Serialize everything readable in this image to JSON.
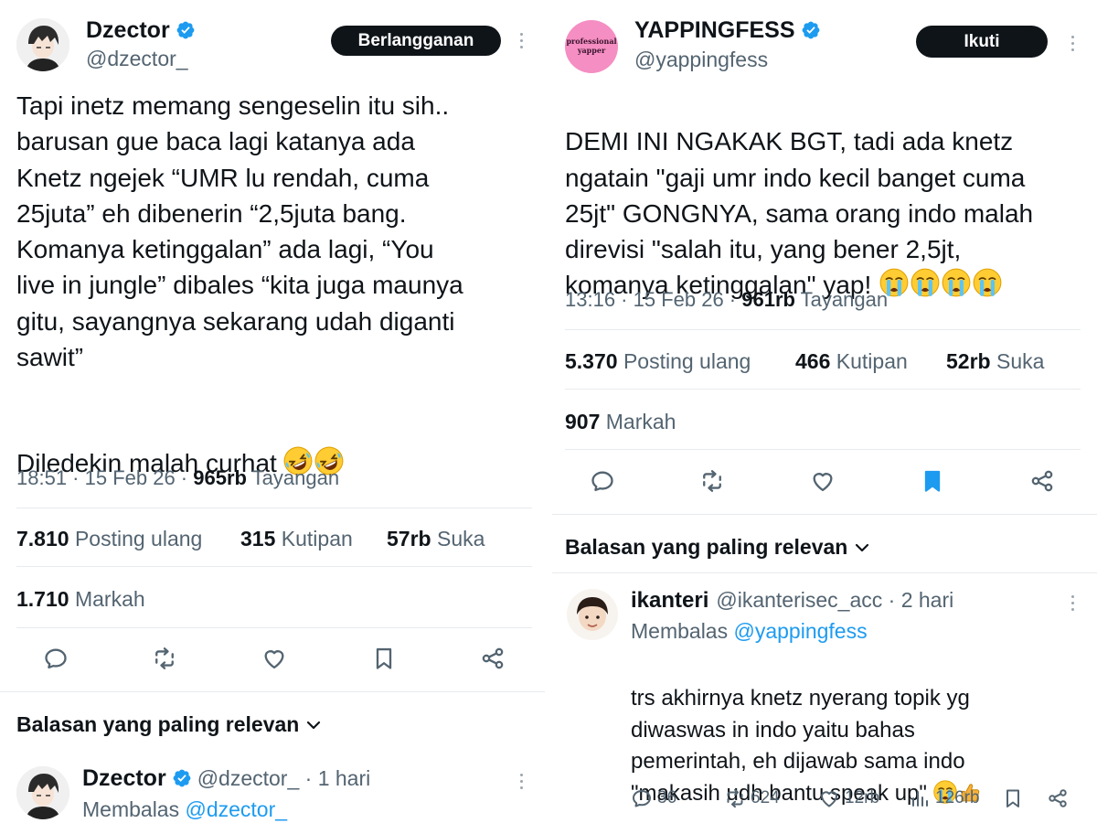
{
  "left": {
    "author": {
      "name": "Dzector",
      "handle": "@dzector_"
    },
    "subscribe_label": "Berlangganan",
    "tweet_text": "Tapi inetz memang sengeselin itu sih..\nbarusan gue baca lagi katanya ada\nKnetz ngejek “UMR lu rendah, cuma\n25juta” eh dibenerin “2,5juta bang.\nKomanya ketinggalan” ada lagi, “You\nlive in jungle” dibales “kita juga maunya\ngitu, sayangnya sekarang udah diganti\nsawit”",
    "tweet_text2": "Diledekin malah curhat",
    "meta": {
      "time": "18:51 · 15 Feb 26 · ",
      "views": "965rb",
      "views_label": " Tayangan"
    },
    "stats": {
      "reposts": "7.810",
      "reposts_label": " Posting ulang",
      "quotes": "315",
      "quotes_label": " Kutipan",
      "likes": "57rb",
      "likes_label": " Suka",
      "bookmarks": "1.710",
      "bookmarks_label": " Markah"
    },
    "replies_header": "Balasan yang paling relevan",
    "reply": {
      "name": "Dzector",
      "handle": "@dzector_",
      "time": " · 1 hari",
      "replying_label": "Membalas ",
      "replying_to": "@dzector_"
    }
  },
  "right": {
    "author": {
      "name": "YAPPINGFESS",
      "handle": "@yappingfess",
      "avatar_text": "professional yapper"
    },
    "follow_label": "Ikuti",
    "tweet_text": "DEMI INI NGAKAK BGT, tadi ada knetz\nngatain \"gaji umr indo kecil banget cuma\n25jt\" GONGNYA, sama orang indo malah\ndirevisi \"salah itu, yang bener 2,5jt,\nkomanya ketinggalan\" yap!",
    "meta": {
      "time": "13:16 · 15 Feb 26 · ",
      "views": "961rb",
      "views_label": " Tayangan"
    },
    "stats": {
      "reposts": "5.370",
      "reposts_label": " Posting ulang",
      "quotes": "466",
      "quotes_label": " Kutipan",
      "likes": "52rb",
      "likes_label": " Suka",
      "bookmarks": "907",
      "bookmarks_label": " Markah"
    },
    "replies_header": "Balasan yang paling relevan",
    "reply": {
      "name": "ikanteri",
      "handle": "@ikanterisec_acc",
      "time": " · 2 hari",
      "replying_label": "Membalas ",
      "replying_to": "@yappingfess",
      "text": "trs akhirnya knetz nyerang topik yg\ndiwaswas in indo yaitu bahas\npemerintah, eh dijawab sama indo\n\"makasih udh bantu speak up\"",
      "replies": "36",
      "reposts": "624",
      "likes": "12rb",
      "views": "126rb"
    }
  },
  "colors": {
    "accent": "#1d9bf0",
    "text": "#0f1419",
    "muted": "#536471",
    "divider": "#e7ebee",
    "pill": "#0f1419"
  }
}
